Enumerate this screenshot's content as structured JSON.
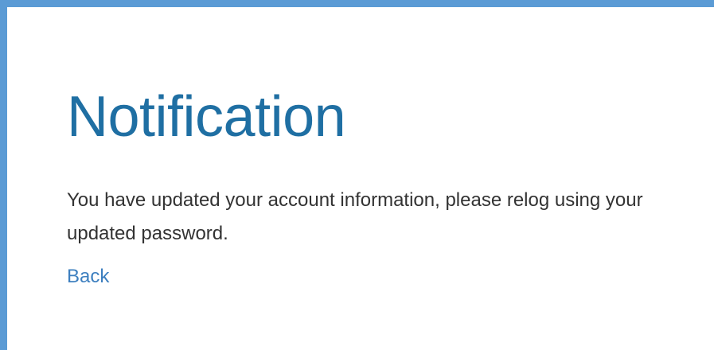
{
  "notification": {
    "title": "Notification",
    "message": "You have updated your account information, please relog using your updated password.",
    "back_label": "Back"
  },
  "colors": {
    "frame_border": "#5b9bd5",
    "title": "#1f6fa3",
    "body_text": "#333333",
    "link": "#3d7fbf"
  }
}
